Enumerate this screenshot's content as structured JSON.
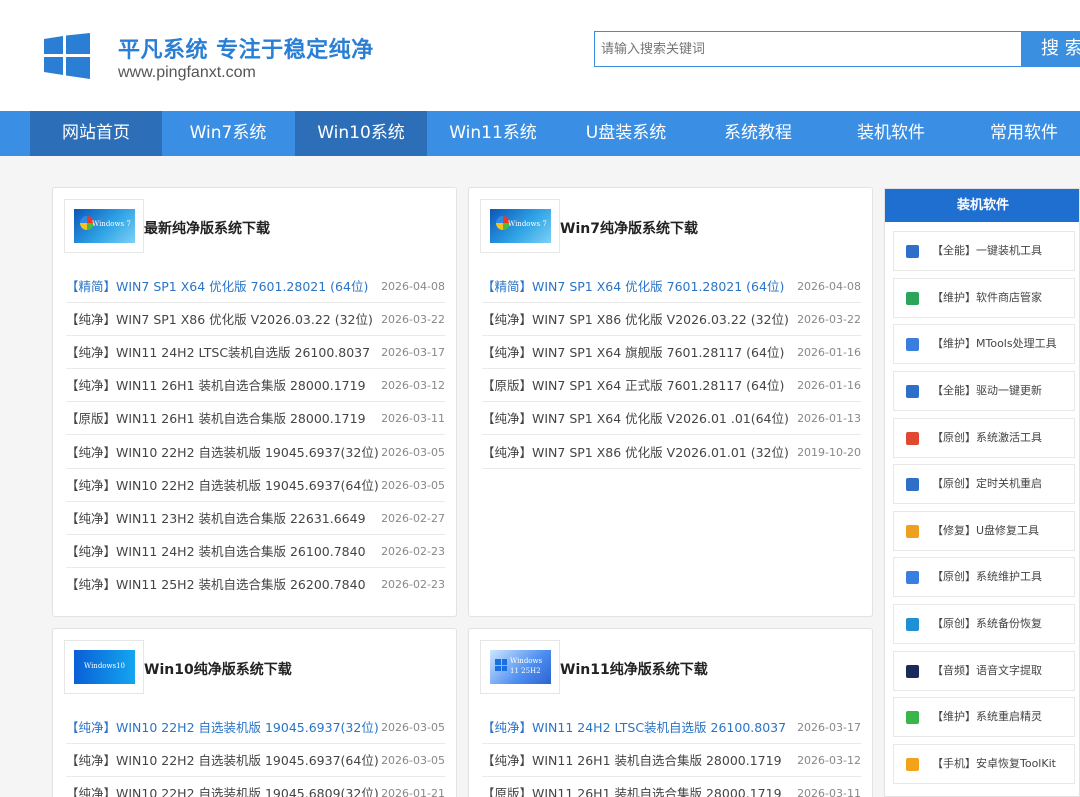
{
  "header": {
    "brand": "平凡系统 专注于稳定纯净",
    "domain": "www.pingfanxt.com",
    "search_placeholder": "请输入搜索关键词",
    "search_button": "搜 索"
  },
  "nav": [
    {
      "label": "网站首页",
      "active": true
    },
    {
      "label": "Win7系统",
      "active": false
    },
    {
      "label": "Win10系统",
      "active": true
    },
    {
      "label": "Win11系统",
      "active": false
    },
    {
      "label": "U盘装系统",
      "active": false
    },
    {
      "label": "系统教程",
      "active": false
    },
    {
      "label": "装机软件",
      "active": false
    },
    {
      "label": "常用软件",
      "active": false
    }
  ],
  "panels": [
    {
      "title": "最新纯净版系统下载",
      "thumb_text": "Windows 7",
      "rows": [
        {
          "title": "【精简】WIN7 SP1 X64 优化版 7601.28021 (64位)",
          "date": "2026-04-08",
          "highlight": true
        },
        {
          "title": "【纯净】WIN7 SP1 X86 优化版 V2026.03.22 (32位)",
          "date": "2026-03-22"
        },
        {
          "title": "【纯净】WIN11 24H2 LTSC装机自选版 26100.8037",
          "date": "2026-03-17"
        },
        {
          "title": "【纯净】WIN11 26H1 装机自选合集版 28000.1719",
          "date": "2026-03-12"
        },
        {
          "title": "【原版】WIN11 26H1 装机自选合集版 28000.1719",
          "date": "2026-03-11"
        },
        {
          "title": "【纯净】WIN10 22H2 自选装机版 19045.6937(32位)",
          "date": "2026-03-05"
        },
        {
          "title": "【纯净】WIN10 22H2 自选装机版 19045.6937(64位)",
          "date": "2026-03-05"
        },
        {
          "title": "【纯净】WIN11 23H2 装机自选合集版 22631.6649",
          "date": "2026-02-27"
        },
        {
          "title": "【纯净】WIN11 24H2 装机自选合集版 26100.7840",
          "date": "2026-02-23"
        },
        {
          "title": "【纯净】WIN11 25H2 装机自选合集版 26200.7840",
          "date": "2026-02-23"
        }
      ]
    },
    {
      "title": "Win7纯净版系统下载",
      "thumb_text": "Windows 7",
      "rows": [
        {
          "title": "【精简】WIN7 SP1 X64 优化版 7601.28021 (64位)",
          "date": "2026-04-08",
          "highlight": true
        },
        {
          "title": "【纯净】WIN7 SP1 X86 优化版 V2026.03.22 (32位)",
          "date": "2026-03-22"
        },
        {
          "title": "【纯净】WIN7 SP1 X64 旗舰版 7601.28117 (64位)",
          "date": "2026-01-16"
        },
        {
          "title": "【原版】WIN7 SP1 X64 正式版 7601.28117 (64位)",
          "date": "2026-01-16"
        },
        {
          "title": "【纯净】WIN7 SP1 X64 优化版 V2026.01 .01(64位)",
          "date": "2026-01-13"
        },
        {
          "title": "【纯净】WIN7 SP1 X86 优化版 V2026.01.01 (32位)",
          "date": "2019-10-20"
        }
      ]
    },
    {
      "title": "Win10纯净版系统下载",
      "thumb_text": "Windows10",
      "rows": [
        {
          "title": "【纯净】WIN10 22H2 自选装机版 19045.6937(32位)",
          "date": "2026-03-05",
          "highlight": true
        },
        {
          "title": "【纯净】WIN10 22H2 自选装机版 19045.6937(64位)",
          "date": "2026-03-05"
        },
        {
          "title": "【纯净】WIN10 22H2 自选装机版 19045.6809(32位)",
          "date": "2026-01-21"
        }
      ]
    },
    {
      "title": "Win11纯净版系统下载",
      "thumb_text": "Windows 11 25H2",
      "rows": [
        {
          "title": "【纯净】WIN11 24H2 LTSC装机自选版 26100.8037",
          "date": "2026-03-17",
          "highlight": true
        },
        {
          "title": "【纯净】WIN11 26H1 装机自选合集版 28000.1719",
          "date": "2026-03-12"
        },
        {
          "title": "【原版】WIN11 26H1 装机自选合集版 28000.1719",
          "date": "2026-03-11"
        }
      ]
    }
  ],
  "sidebar": {
    "title": "装机软件",
    "items": [
      {
        "label": "【全能】一键装机工具",
        "icon": "monitor-icon",
        "color": "#2d6fc9"
      },
      {
        "label": "【维护】软件商店管家",
        "icon": "store-icon",
        "color": "#2aa55a"
      },
      {
        "label": "【维护】MTools处理工具",
        "icon": "toolbox-icon",
        "color": "#3a7fe0"
      },
      {
        "label": "【全能】驱动一键更新",
        "icon": "driver-icon",
        "color": "#2d6fc9"
      },
      {
        "label": "【原创】系统激活工具",
        "icon": "windows-icon",
        "color": "#e0492f"
      },
      {
        "label": "【原创】定时关机重启",
        "icon": "monitor-icon",
        "color": "#2d6fc9"
      },
      {
        "label": "【修复】U盘修复工具",
        "icon": "usb-icon",
        "color": "#f0a020"
      },
      {
        "label": "【原创】系统维护工具",
        "icon": "wrench-icon",
        "color": "#3a7fe0"
      },
      {
        "label": "【原创】系统备份恢复",
        "icon": "backup-icon",
        "color": "#1e90d8"
      },
      {
        "label": "【音频】语音文字提取",
        "icon": "audio-icon",
        "color": "#1b2a5a"
      },
      {
        "label": "【维护】系统重启精灵",
        "icon": "shield-icon",
        "color": "#3ab54a"
      },
      {
        "label": "【手机】安卓恢复ToolKit",
        "icon": "restore-icon",
        "color": "#f2a31b"
      }
    ]
  }
}
